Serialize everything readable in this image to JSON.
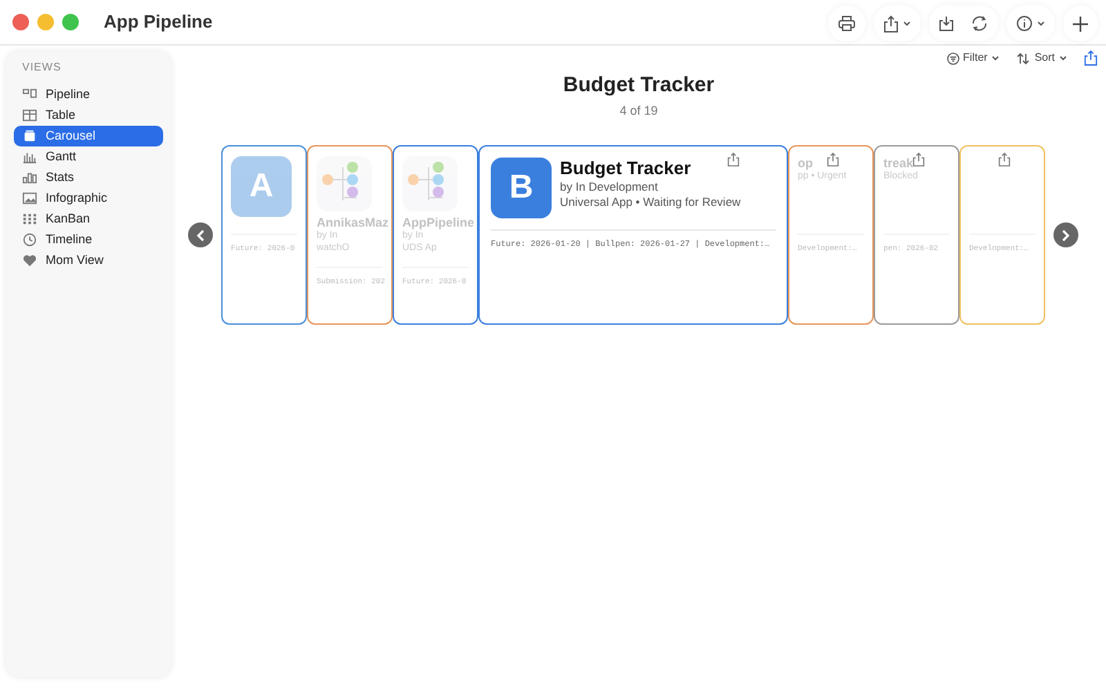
{
  "window": {
    "title": "App Pipeline"
  },
  "sidebar": {
    "heading": "VIEWS",
    "items": [
      {
        "label": "Pipeline",
        "selected": false
      },
      {
        "label": "Table",
        "selected": false
      },
      {
        "label": "Carousel",
        "selected": true
      },
      {
        "label": "Gantt",
        "selected": false
      },
      {
        "label": "Stats",
        "selected": false
      },
      {
        "label": "Infographic",
        "selected": false
      },
      {
        "label": "KanBan",
        "selected": false
      },
      {
        "label": "Timeline",
        "selected": false
      },
      {
        "label": "Mom View",
        "selected": false
      }
    ]
  },
  "toolbar": {
    "filter": "Filter",
    "sort": "Sort"
  },
  "header": {
    "title": "Budget Tracker",
    "position": "4 of 19"
  },
  "cards": [
    {
      "kind": "letter",
      "letter": "A",
      "color": "#4a90d9",
      "selected": false,
      "footer": "Future: 2026-0",
      "share": false
    },
    {
      "kind": "diagram",
      "color": "#e8955a",
      "selected": false,
      "title": "AnnikasMaz",
      "subtitle": "by In",
      "meta": "watchO",
      "footer": "Submission: 202",
      "share": false
    },
    {
      "kind": "diagram",
      "color": "#3a7fde",
      "selected": false,
      "title": "AppPipeline",
      "subtitle": "by In",
      "meta": "UDS Ap",
      "footer": "Future: 2026-0",
      "share": false
    },
    {
      "kind": "letter",
      "letter": "B",
      "color": "#3a7fde",
      "selected": true,
      "title": "Budget Tracker",
      "subtitle": "by In Development",
      "meta": "Universal App • Waiting for Review",
      "footer": "Future: 2026-01-20 | Bullpen: 2026-01-27 | Development:…",
      "share": true
    },
    {
      "kind": "text",
      "color": "#e8955a",
      "selected": false,
      "title": "op",
      "meta": "pp • Urgent",
      "footer": "Development:…",
      "share": true
    },
    {
      "kind": "text",
      "color": "#9a9a9a",
      "selected": false,
      "title": "treak",
      "meta": "Blocked",
      "footer": "pen: 2026-02",
      "share": true
    },
    {
      "kind": "text",
      "color": "#f0c060",
      "selected": false,
      "footer": "Development:…",
      "share": true
    }
  ]
}
